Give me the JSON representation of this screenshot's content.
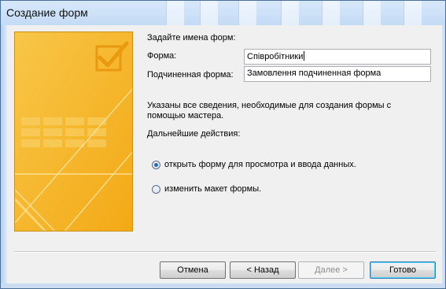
{
  "window": {
    "title": "Создание форм"
  },
  "wizard": {
    "heading": "Задайте имена форм:",
    "form_label": "Форма:",
    "form_value": "Співробітники",
    "subform_label": "Подчиненная форма:",
    "subform_value": "Замовлення подчиненная форма",
    "info_line1": "Указаны все сведения, необходимые для создания формы с",
    "info_line2": "помощью мастера.",
    "next_actions_label": "Дальнейшие действия:",
    "options": [
      {
        "label": "открыть форму для просмотра и ввода данных.",
        "selected": true
      },
      {
        "label": "изменить макет формы.",
        "selected": false
      }
    ]
  },
  "buttons": {
    "cancel": "Отмена",
    "back": "< Назад",
    "next": "Далее >",
    "finish": "Готово"
  },
  "colors": {
    "art_primary": "#f6b221",
    "title_bar": "#c4dbf5"
  },
  "icons": {
    "art": "form-wizard-checkmark-illustration"
  }
}
